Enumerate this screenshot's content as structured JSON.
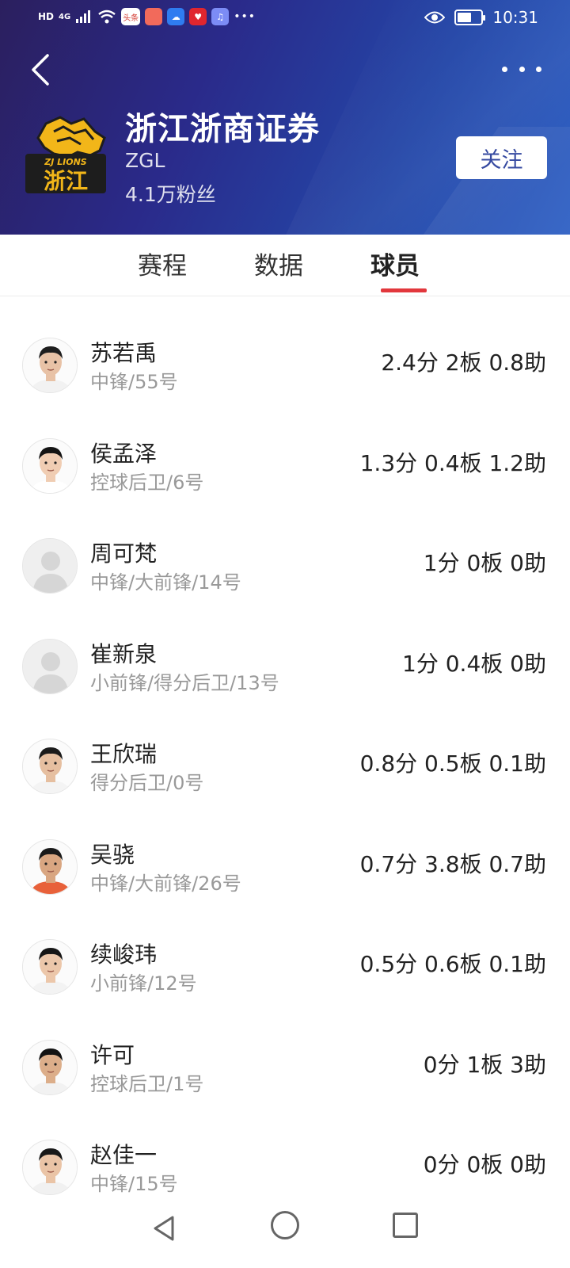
{
  "status_bar": {
    "time": "10:31",
    "left_badges": [
      "HD",
      "4G",
      "头条"
    ],
    "icons": [
      "signal-icon",
      "wifi-icon",
      "toutiao-icon",
      "red-app-icon",
      "cloud-icon",
      "heart-app-icon",
      "music-icon",
      "more-dots-icon",
      "eye-icon",
      "battery-icon"
    ],
    "battery_level": 0.6
  },
  "header": {
    "team_name": "浙江浙商证券",
    "league": "ZGL",
    "fans": "4.1万粉丝",
    "follow_label": "关注",
    "logo_text_top": "ZJ LIONS",
    "logo_text_bottom": "浙江"
  },
  "tabs": {
    "items": [
      "赛程",
      "数据",
      "球员"
    ],
    "active": "球员"
  },
  "players": [
    {
      "name": "苏若禹",
      "position": "中锋/55号",
      "stats": "2.4分 2板 0.8助"
    },
    {
      "name": "侯孟泽",
      "position": "控球后卫/6号",
      "stats": "1.3分 0.4板 1.2助"
    },
    {
      "name": "周可梵",
      "position": "中锋/大前锋/14号",
      "stats": "1分 0板 0助"
    },
    {
      "name": "崔新泉",
      "position": "小前锋/得分后卫/13号",
      "stats": "1分 0.4板 0助"
    },
    {
      "name": "王欣瑞",
      "position": "得分后卫/0号",
      "stats": "0.8分 0.5板 0.1助"
    },
    {
      "name": "吴骁",
      "position": "中锋/大前锋/26号",
      "stats": "0.7分 3.8板 0.7助"
    },
    {
      "name": "续峻玮",
      "position": "小前锋/12号",
      "stats": "0.5分 0.6板 0.1助"
    },
    {
      "name": "许可",
      "position": "控球后卫/1号",
      "stats": "0分 1板 3助"
    },
    {
      "name": "赵佳一",
      "position": "中锋/15号",
      "stats": "0分 0板 0助"
    }
  ],
  "colors": {
    "header_start": "#2b1f5e",
    "header_end": "#2d5fc4",
    "tab_indicator": "#e2373c",
    "follow_text": "#2a3f9c"
  }
}
